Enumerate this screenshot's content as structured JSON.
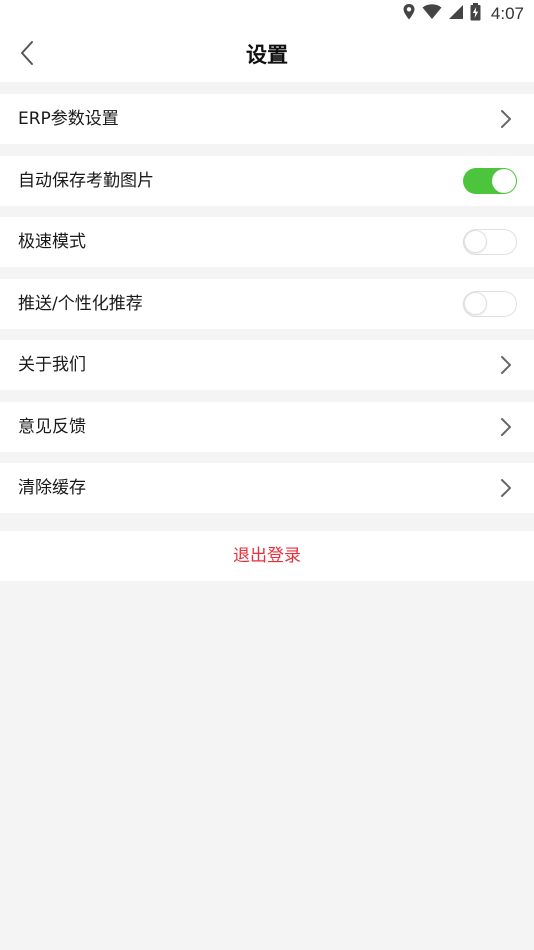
{
  "status_bar": {
    "time": "4:07",
    "icons": [
      "location-icon",
      "wifi-icon",
      "signal-icon",
      "battery-charging-icon"
    ]
  },
  "header": {
    "title": "设置",
    "back_icon": "chevron-left-icon"
  },
  "settings": {
    "erp_params": {
      "label": "ERP参数设置"
    },
    "auto_save_photo": {
      "label": "自动保存考勤图片",
      "enabled": true
    },
    "fast_mode": {
      "label": "极速模式",
      "enabled": false
    },
    "push_personalized": {
      "label": "推送/个性化推荐",
      "enabled": false
    },
    "about_us": {
      "label": "关于我们"
    },
    "feedback": {
      "label": "意见反馈"
    },
    "clear_cache": {
      "label": "清除缓存"
    }
  },
  "logout": {
    "label": "退出登录"
  },
  "colors": {
    "toggle_on": "#4cc43c",
    "logout_text": "#e8303c",
    "page_background": "#f4f4f4"
  }
}
